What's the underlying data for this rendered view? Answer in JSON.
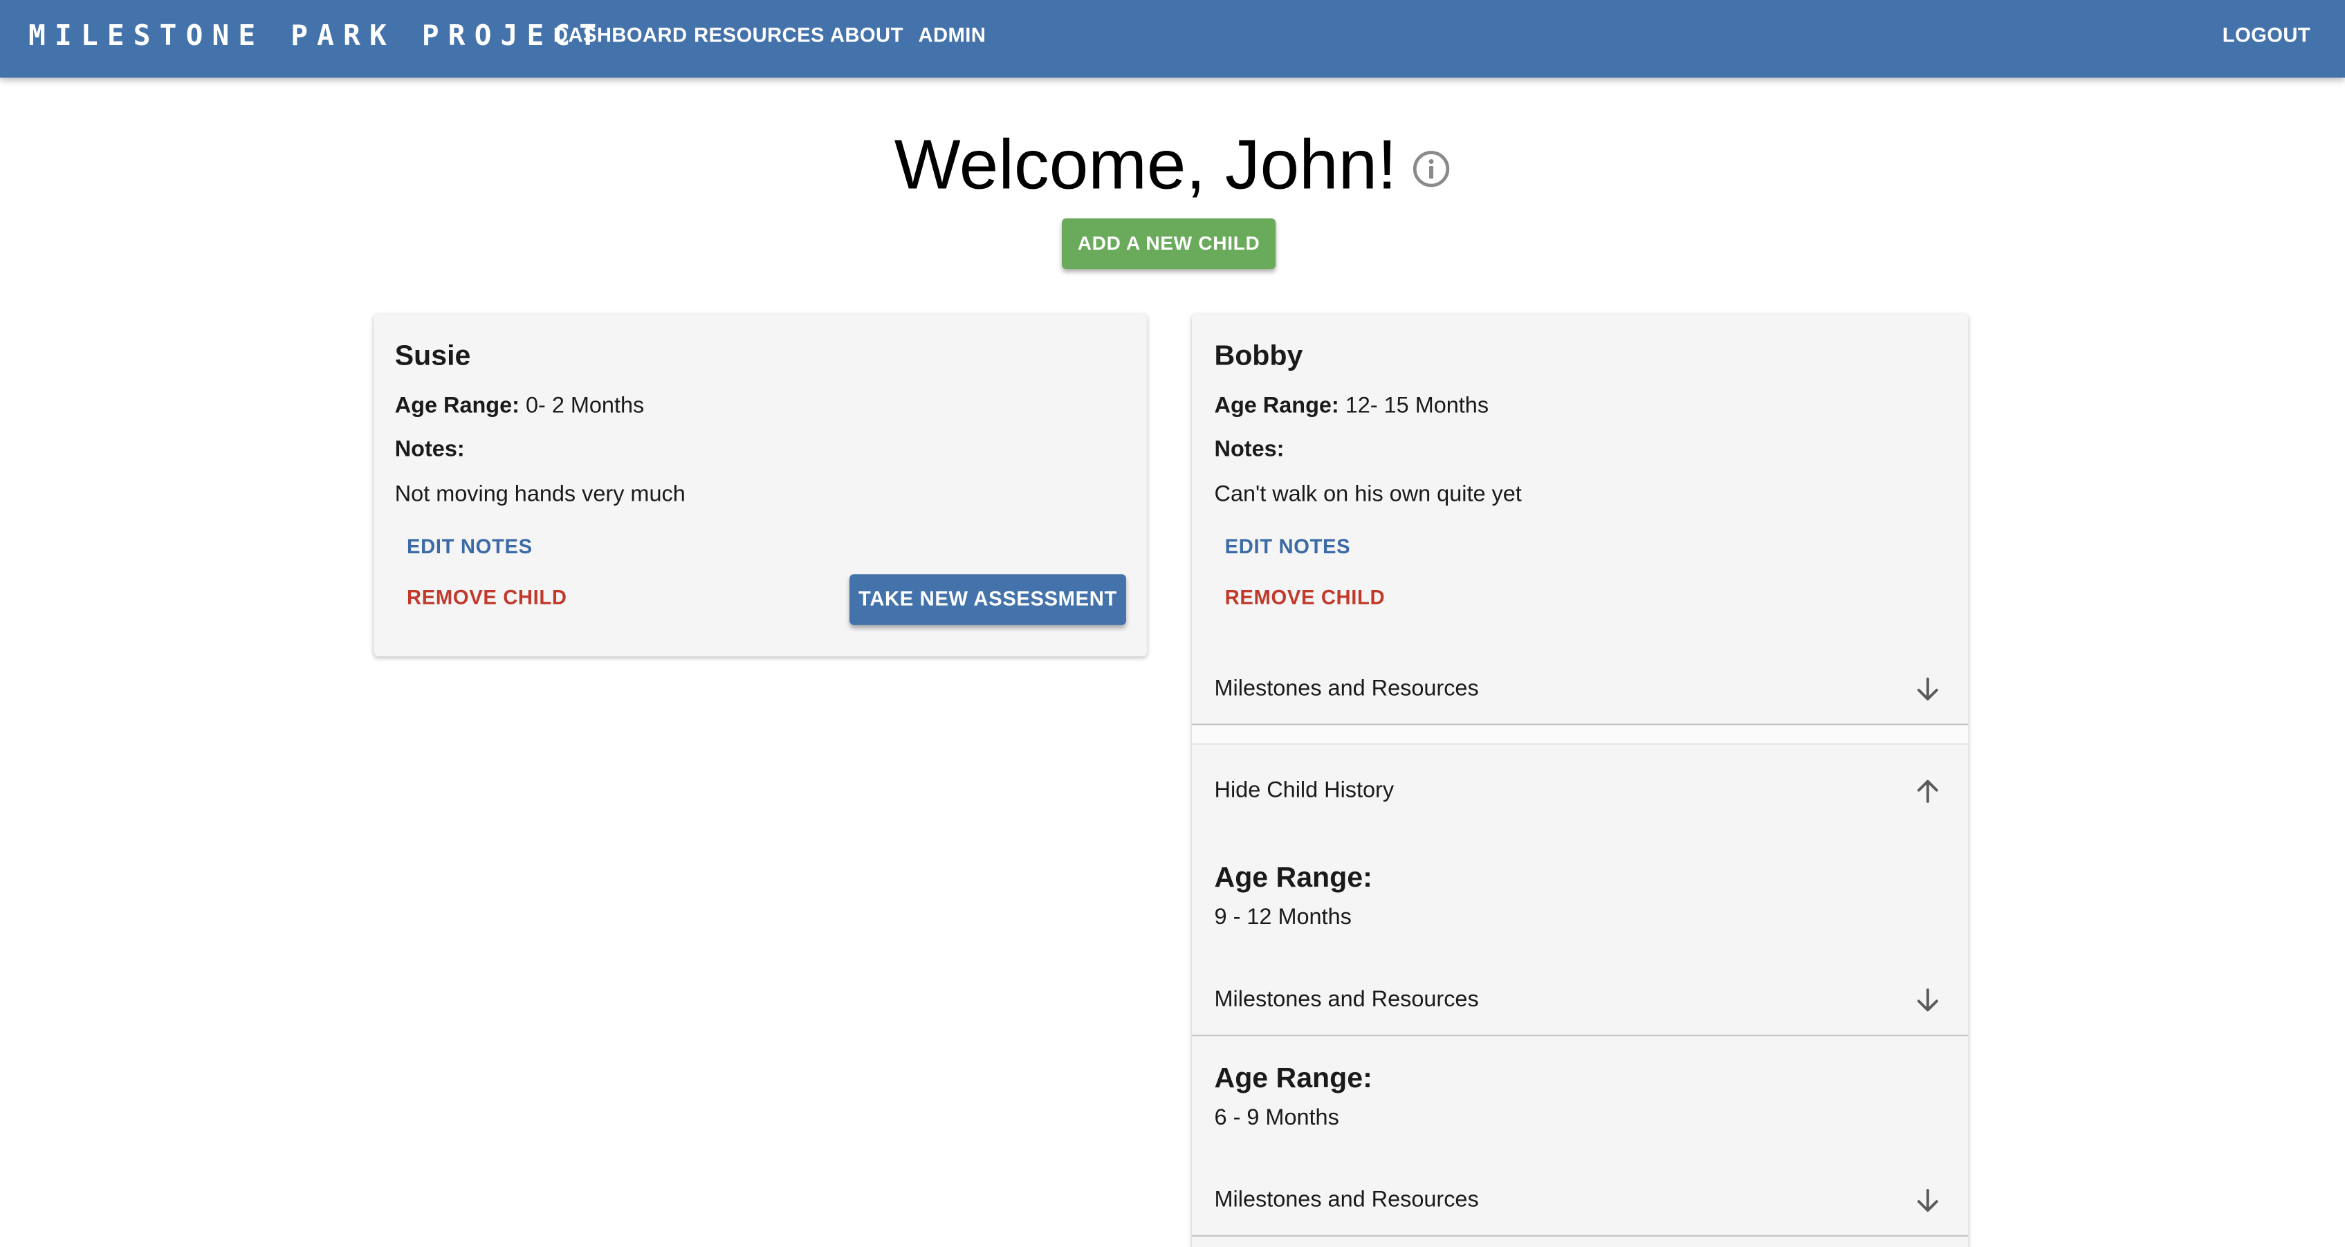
{
  "appbar": {
    "brand": "MILESTONE PARK PROJECT",
    "nav": [
      "DASHBOARD",
      "RESOURCES",
      "ABOUT",
      "ADMIN"
    ],
    "logout": "LOGOUT",
    "color": "#4472aa"
  },
  "welcome": {
    "title": "Welcome, John!",
    "icon": "info-icon",
    "add_child_label": "ADD A NEW CHILD",
    "add_child_color": "#6aaa5b"
  },
  "children": [
    {
      "name": "Susie",
      "age_label": "Age Range:",
      "age_value": "0- 2 Months",
      "notes_label": "Notes:",
      "notes": "Not moving hands very much",
      "edit_notes": "EDIT NOTES",
      "remove_child": "REMOVE CHILD",
      "take_assessment": "TAKE NEW ASSESSMENT"
    },
    {
      "name": "Bobby",
      "age_label": "Age Range:",
      "age_value": "12- 15 Months",
      "notes_label": "Notes:",
      "notes": "Can't walk on his own quite yet",
      "edit_notes": "EDIT NOTES",
      "remove_child": "REMOVE CHILD",
      "milestones_label": "Milestones and Resources",
      "history_toggle": "Hide Child History",
      "history": [
        {
          "age_label": "Age Range:",
          "age_value": "9 - 12 Months",
          "milestones_label": "Milestones and Resources"
        },
        {
          "age_label": "Age Range:",
          "age_value": "6 - 9 Months",
          "milestones_label": "Milestones and Resources"
        }
      ]
    }
  ],
  "colors": {
    "link_blue": "#3b6aa6",
    "danger_red": "#c0392b",
    "card_bg": "#f5f5f5"
  }
}
